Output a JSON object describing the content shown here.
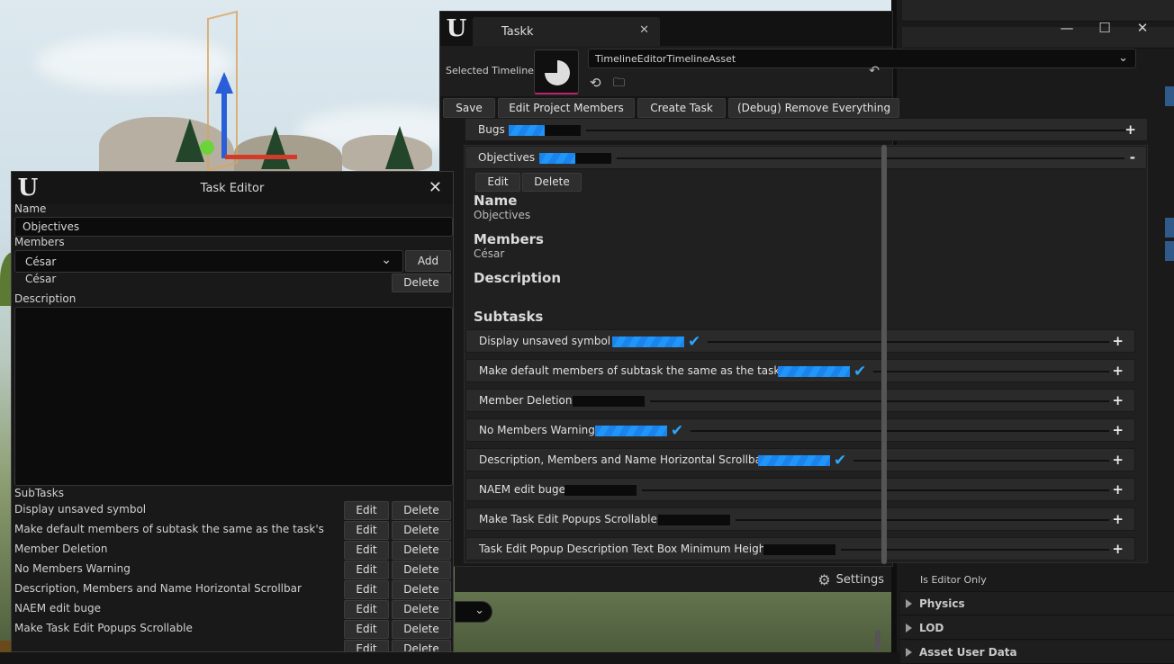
{
  "taskk_window": {
    "tab_title": "Taskk",
    "selected_timeline_label": "Selected Timeline",
    "timeline_asset": "TimelineEditorTimelineAsset",
    "toolbar": {
      "save": "Save",
      "edit_members": "Edit Project Members",
      "create_task": "Create Task",
      "remove_everything": "(Debug) Remove Everything"
    },
    "categories": [
      {
        "name": "Bugs",
        "progress": 0.5,
        "toggle": "+"
      },
      {
        "name": "Objectives",
        "progress": 0.5,
        "toggle": "-"
      }
    ],
    "objective": {
      "edit": "Edit",
      "delete": "Delete",
      "name_heading": "Name",
      "name_value": "Objectives",
      "members_heading": "Members",
      "members_value": "César",
      "description_heading": "Description",
      "subtasks_heading": "Subtasks"
    },
    "subtasks": [
      {
        "name": "Display unsaved symbol",
        "progress": 1.0,
        "done": true
      },
      {
        "name": "Make default members of subtask the same as the task's",
        "progress": 1.0,
        "done": true
      },
      {
        "name": "Member Deletion",
        "progress": 0.0,
        "done": false
      },
      {
        "name": "No Members Warning",
        "progress": 1.0,
        "done": true
      },
      {
        "name": "Description, Members and Name Horizontal Scrollbar",
        "progress": 1.0,
        "done": true
      },
      {
        "name": "NAEM edit buge",
        "progress": 0.0,
        "done": false
      },
      {
        "name": "Make Task Edit Popups Scrollable",
        "progress": 0.0,
        "done": false
      },
      {
        "name": "Task Edit Popup Description Text Box Minimum Height",
        "progress": 0.0,
        "done": false
      }
    ],
    "toggle_plus": "+",
    "check_glyph": "✔"
  },
  "task_editor": {
    "title": "Task Editor",
    "name_label": "Name",
    "name_value": "Objectives",
    "members_label": "Members",
    "member_select": "César",
    "add": "Add",
    "member_item": "César",
    "delete": "Delete",
    "description_label": "Description",
    "description_value": "",
    "subtasks_label": "SubTasks",
    "edit": "Edit",
    "subtasks": [
      "Display unsaved symbol",
      "Make default members of subtask the same as the task's",
      "Member Deletion",
      "No Members Warning",
      "Description, Members and Name Horizontal Scrollbar",
      "NAEM edit buge",
      "Make Task Edit Popups Scrollable"
    ]
  },
  "details_panel": {
    "is_editor_only": "Is Editor Only",
    "physics": "Physics",
    "lod": "LOD",
    "asset_user_data": "Asset User Data"
  },
  "bottom_toolbar": {
    "settings": "Settings"
  },
  "icons": {
    "close": "✕",
    "minimize": "—",
    "maximize": "☐",
    "chevron_down": "⌄",
    "gear": "⚙",
    "back": "⟲",
    "browse": "🗀",
    "reset": "↶",
    "ue_logo": "U"
  },
  "colors": {
    "progress_fill": "#1a84ec",
    "check": "#2ba7ff",
    "thumb_accent": "#c0236a"
  }
}
